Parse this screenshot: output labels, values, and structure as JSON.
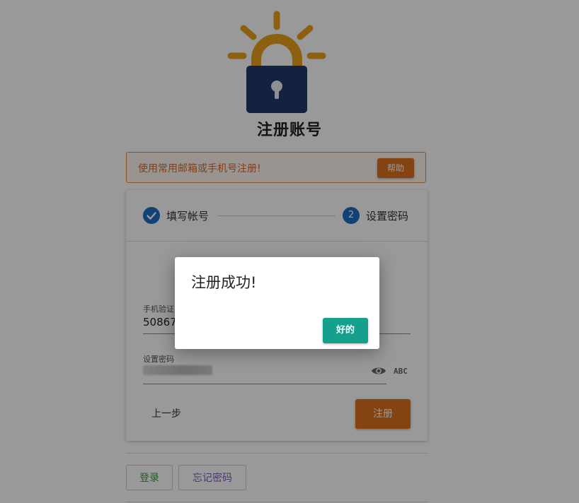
{
  "header": {
    "title": "注册账号"
  },
  "notice": {
    "text": "使用常用邮箱或手机号注册!",
    "help_label": "帮助"
  },
  "stepper": {
    "steps": [
      {
        "label": "填写帐号",
        "state": "done",
        "icon": "check-icon"
      },
      {
        "label": "设置密码",
        "state": "active",
        "number": "2"
      }
    ]
  },
  "form": {
    "phone_code": {
      "label": "手机验证",
      "value": "50867"
    },
    "password": {
      "label": "设置密码",
      "value_state": "blurred/masked",
      "toggle_icon": "eye-icon",
      "mode_label": "ABC"
    },
    "prev_label": "上一步",
    "submit_label": "注册"
  },
  "footer": {
    "login_label": "登录",
    "forgot_label": "忘记密码"
  },
  "dialog": {
    "title": "注册成功!",
    "ok_label": "好的"
  },
  "colors": {
    "accent_orange": "#e0701e",
    "primary_blue": "#1e6fc4",
    "teal": "#14a08c",
    "logo_gold": "#e8a21c",
    "logo_navy": "#1f3a6b"
  }
}
